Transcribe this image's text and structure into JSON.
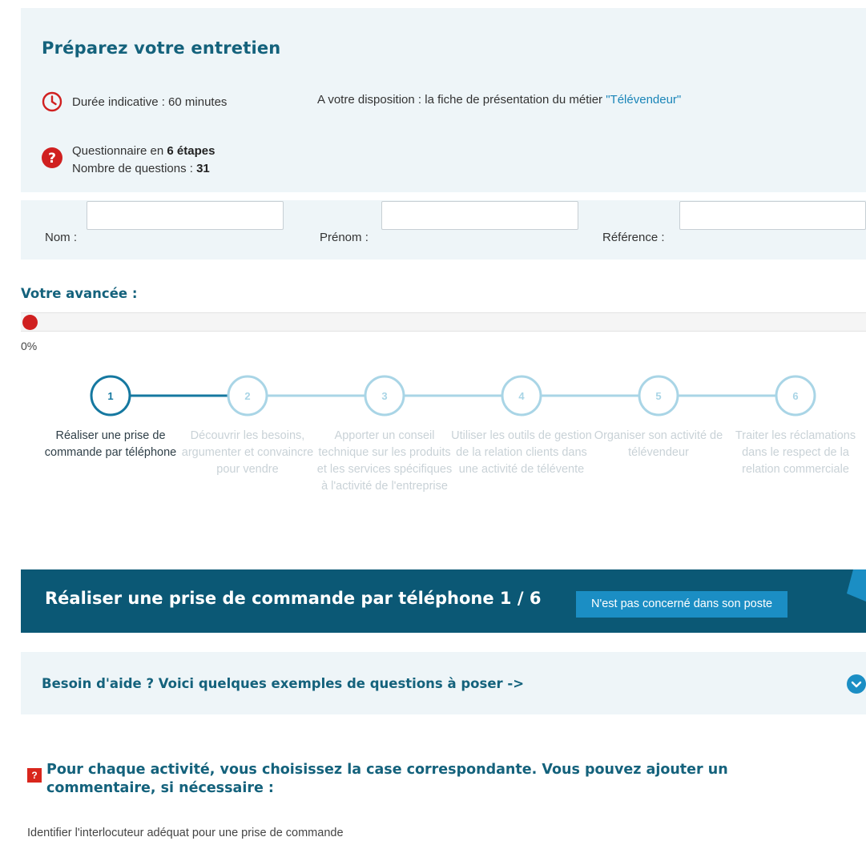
{
  "prep": {
    "title": "Préparez votre entretien",
    "duration_label": "Durée indicative : 60 minutes",
    "steps_prefix": "Questionnaire en ",
    "steps_value": "6 étapes",
    "questions_prefix": "Nombre de questions : ",
    "questions_value": "31",
    "disposition_prefix": "A votre disposition : la fiche de présentation du métier ",
    "disposition_link": "\"Télévendeur\"",
    "icons": {
      "duration": "clock-icon",
      "questions": "question-icon"
    }
  },
  "form": {
    "nom_label": "Nom :",
    "prenom_label": "Prénom :",
    "reference_label": "Référence :",
    "nom_value": "",
    "prenom_value": "",
    "reference_value": ""
  },
  "progress": {
    "title": "Votre avancée :",
    "percent_label": "0%",
    "value": 0
  },
  "steps": [
    {
      "number": "1",
      "label": "Réaliser une prise de commande par téléphone",
      "active": true
    },
    {
      "number": "2",
      "label": "Découvrir les besoins, argumenter et convaincre pour vendre",
      "active": false
    },
    {
      "number": "3",
      "label": "Apporter un conseil technique sur les produits et les services spécifiques à l'activité de l'entreprise",
      "active": false
    },
    {
      "number": "4",
      "label": "Utiliser les outils de gestion de la relation clients dans une activité de télévente",
      "active": false
    },
    {
      "number": "5",
      "label": "Organiser son activité de télévendeur",
      "active": false
    },
    {
      "number": "6",
      "label": "Traiter les réclamations dans le respect de la relation commerciale",
      "active": false
    }
  ],
  "section": {
    "title": "Réaliser une prise de commande par téléphone 1 / 6",
    "not_concerned_label": "N'est pas concerné dans son poste"
  },
  "help": {
    "title": "Besoin d'aide ? Voici quelques exemples de questions à poser ->",
    "icon": "chevron-down-icon"
  },
  "instruction": {
    "icon_glyph": "?",
    "text": "Pour chaque activité, vous choisissez la case correspondante. Vous pouvez ajouter un commentaire, si nécessaire :"
  },
  "activities": [
    "Identifier l'interlocuteur adéquat pour une prise de commande"
  ],
  "colors": {
    "brand_dark": "#0b5875",
    "title_blue": "#14627c",
    "accent_blue": "#1b8ec4",
    "step_active": "#1578a0",
    "step_inactive": "#a9d5e6",
    "alert_red": "#d02020",
    "panel_bg": "#eef5f8"
  }
}
